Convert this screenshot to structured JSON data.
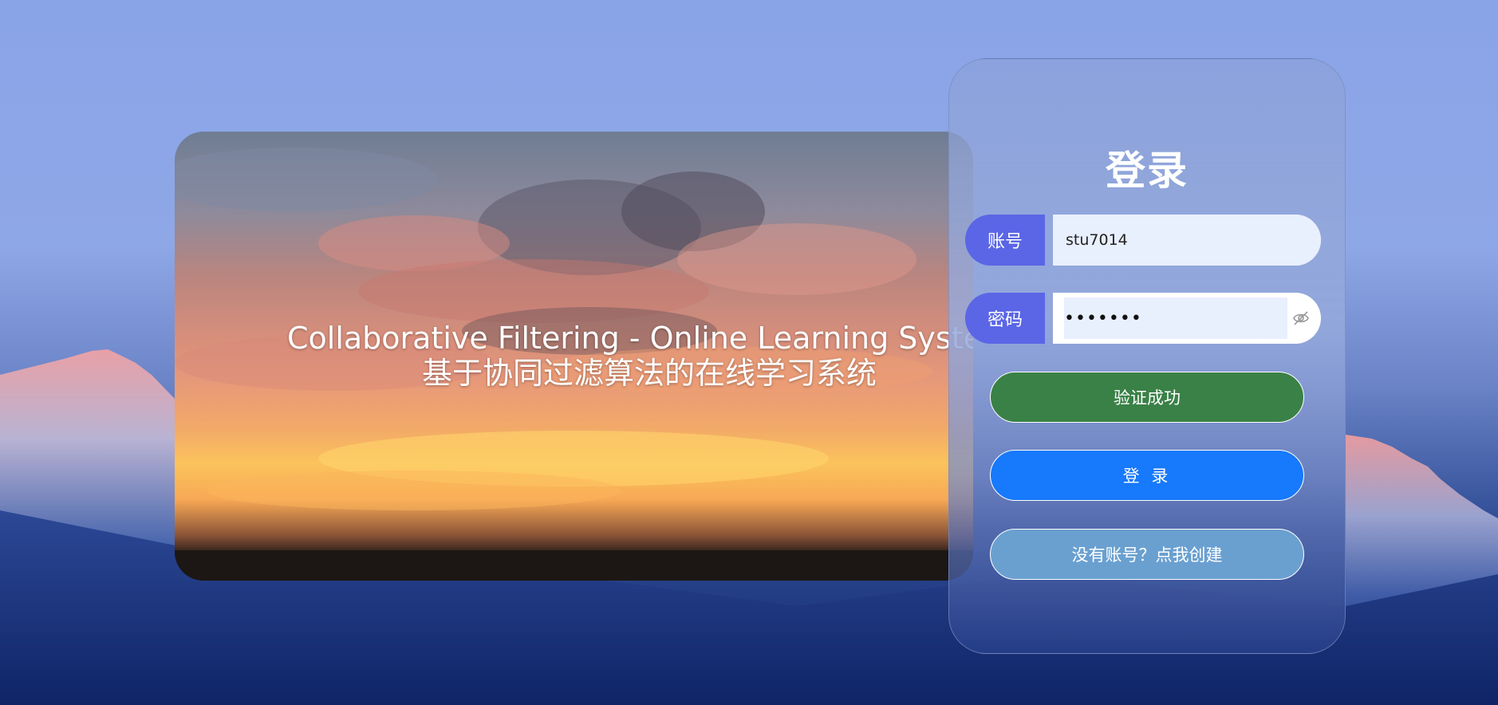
{
  "banner": {
    "title_en": "Collaborative Filtering - Online Learning System",
    "title_cn": "基于协同过滤算法的在线学习系统"
  },
  "login": {
    "title": "登录",
    "account": {
      "label": "账号",
      "value": "stu7014"
    },
    "password": {
      "label": "密码",
      "value": "1234567"
    },
    "verify_button": "验证成功",
    "login_button": "登 录",
    "register_button": "没有账号？点我创建"
  },
  "icons": {
    "password_toggle": "eye-slash-icon"
  },
  "colors": {
    "label_bg": "#5a66e6",
    "verify_bg": "#3a8147",
    "login_bg": "#1779fb",
    "register_bg": "#6aa0d0"
  }
}
